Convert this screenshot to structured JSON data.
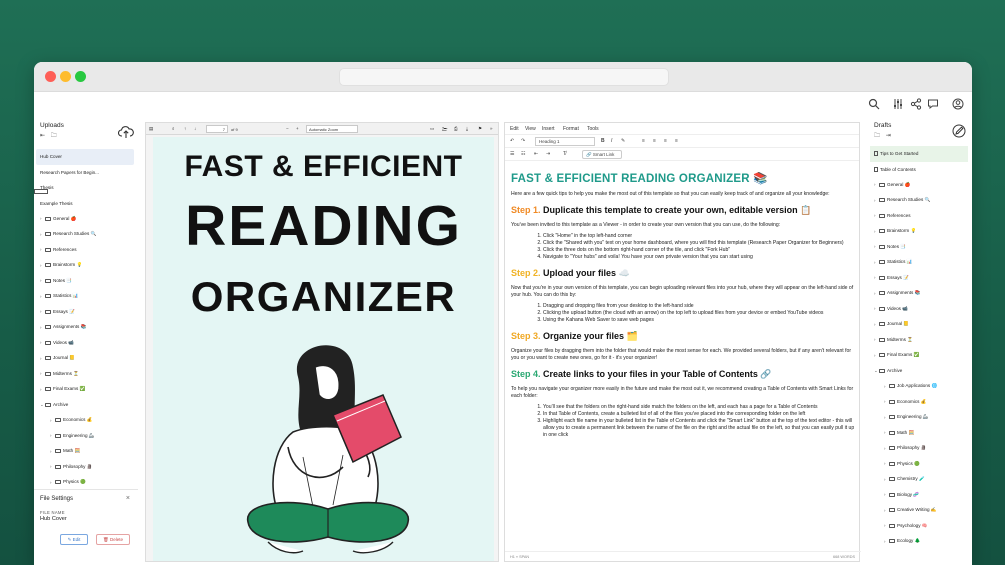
{
  "left_sidebar": {
    "title": "Uploads",
    "items": [
      {
        "label": "Hub Cover",
        "type": "file",
        "selected": true,
        "indent": 0
      },
      {
        "label": "Research Papers for Begin...",
        "type": "file",
        "indent": 0
      },
      {
        "label": "Thesis",
        "type": "file",
        "indent": 0
      },
      {
        "label": "Example Thesis",
        "type": "file",
        "indent": 0
      },
      {
        "label": "General 🍎",
        "type": "folder",
        "indent": 0
      },
      {
        "label": "Research Studies 🔍",
        "type": "folder",
        "indent": 0
      },
      {
        "label": "References",
        "type": "folder",
        "indent": 0
      },
      {
        "label": "Brainstorm 💡",
        "type": "folder",
        "indent": 0
      },
      {
        "label": "Notes 📑",
        "type": "folder",
        "indent": 0
      },
      {
        "label": "Statistics 📊",
        "type": "folder",
        "indent": 0
      },
      {
        "label": "Essays 📝",
        "type": "folder",
        "indent": 0
      },
      {
        "label": "Assignments 📚",
        "type": "folder",
        "indent": 0
      },
      {
        "label": "Videos 📹",
        "type": "folder",
        "indent": 0
      },
      {
        "label": "Journal 📒",
        "type": "folder",
        "indent": 0
      },
      {
        "label": "Midterms ⏳",
        "type": "folder",
        "indent": 0
      },
      {
        "label": "Final Exams ✅",
        "type": "folder",
        "indent": 0
      },
      {
        "label": "Archive",
        "type": "folder",
        "indent": 0
      },
      {
        "label": "Economics 💰",
        "type": "folder",
        "indent": 1
      },
      {
        "label": "Engineering 🦾",
        "type": "folder",
        "indent": 1
      },
      {
        "label": "Math 🧮",
        "type": "folder",
        "indent": 1
      },
      {
        "label": "Philosophy 🗿",
        "type": "folder",
        "indent": 1
      },
      {
        "label": "Physics 🟢",
        "type": "folder",
        "indent": 1
      }
    ]
  },
  "file_settings": {
    "title": "File Settings",
    "close": "×",
    "field_label": "FILE NAME",
    "field_value": "Hub Cover",
    "edit_label": "✎ Edit",
    "delete_label": "🗑 Delete"
  },
  "pdf_viewer": {
    "page_current": "7",
    "page_total": "of 9",
    "zoom": "Automatic Zoom",
    "cover_line1": "FAST & EFFICIENT",
    "cover_line2": "READING",
    "cover_line3": "ORGANIZER"
  },
  "editor": {
    "menu": [
      "Edit",
      "View",
      "Insert",
      "Format",
      "Tools"
    ],
    "block_style": "Heading 1",
    "smart_link": "Smart Link",
    "title": "FAST & EFFICIENT READING ORGANIZER 📚",
    "intro": "Here are a few quick tips to help you make the most out of this template so that you can easily keep track of and organize all your knowledge:",
    "step1_num": "Step 1.",
    "step1_title": "Duplicate this template to create your own, editable version 📋",
    "step1_text": "You've been invited to this template as a Viewer - in order to create your own version that you can use, do the following:",
    "step1_items": [
      "Click \"Home\" in the top left-hand corner",
      "Click the \"Shared with you\" text on your home dashboard, where you will find this template (Research Paper Organizer for Beginners)",
      "Click the three dots on the bottom right-hand corner of the tile, and click \"Fork Hub\"",
      "Navigate to \"Your hubs\" and voila! You have your own private version that you can start using"
    ],
    "step2_num": "Step 2.",
    "step2_title": "Upload your files ☁️",
    "step2_text": "Now that you're in your own version of this template, you can begin uploading relevant files into your hub, where they will appear on the left-hand side of your hub. You can do this by:",
    "step2_items": [
      "Dragging and dropping files from your desktop to the left-hand side",
      "Clicking the upload button (the cloud with an arrow) on the top left to upload files from your device or embed YouTube videos",
      "Using the Kahana Web Saver to save web pages"
    ],
    "step3_num": "Step 3.",
    "step3_title": "Organize your files 🗂️",
    "step3_text": "Organize your files by dragging them into the folder that would make the most sense for each. We provided several folders, but if any aren't relevant for you or you want to create new ones, go for it - it's your organizer!",
    "step4_num": "Step 4.",
    "step4_title": "Create links to your files in your Table of Contents 🔗",
    "step4_text": "To help you navigate your organizer more easily in the future and make the most out it, we recommend creating a Table of Contents with Smart Links for each folder:",
    "step4_items": [
      "You'll see that the folders on the right-hand side match the folders on the left, and each has a page for a Table of Contents",
      "In that Table of Contents, create a bulleted list of all of the files you've placed into the corresponding folder on the left",
      "Highlight each file name in your bulleted list in the Table of Contents and click the \"Smart Link\" button at the top of the text editor - this will allow you to create a permanent link between the name of the file on the right and the actual file on the left, so that you can easily pull it up in one click"
    ],
    "status_path": "H1 » SPAN",
    "status_words": "668 WORDS"
  },
  "right_sidebar": {
    "title": "Drafts",
    "items": [
      {
        "label": "Tips to Get Started",
        "type": "doc",
        "selected": true,
        "indent": 0
      },
      {
        "label": "Table of Contents",
        "type": "doc",
        "indent": 0
      },
      {
        "label": "General 🍎",
        "type": "folder",
        "indent": 0
      },
      {
        "label": "Research Studies 🔍",
        "type": "folder",
        "indent": 0
      },
      {
        "label": "References",
        "type": "folder",
        "indent": 0
      },
      {
        "label": "Brainstorm 💡",
        "type": "folder",
        "indent": 0
      },
      {
        "label": "Notes 📑",
        "type": "folder",
        "indent": 0
      },
      {
        "label": "Statistics 📊",
        "type": "folder",
        "indent": 0
      },
      {
        "label": "Essays 📝",
        "type": "folder",
        "indent": 0
      },
      {
        "label": "Assignments 📚",
        "type": "folder",
        "indent": 0
      },
      {
        "label": "Videos 📹",
        "type": "folder",
        "indent": 0
      },
      {
        "label": "Journal 📒",
        "type": "folder",
        "indent": 0
      },
      {
        "label": "Midterms ⏳",
        "type": "folder",
        "indent": 0
      },
      {
        "label": "Final Exams ✅",
        "type": "folder",
        "indent": 0
      },
      {
        "label": "Archive",
        "type": "folder",
        "indent": 0
      },
      {
        "label": "Job Applications 🌐",
        "type": "folder",
        "indent": 1
      },
      {
        "label": "Economics 💰",
        "type": "folder",
        "indent": 1
      },
      {
        "label": "Engineering 🦾",
        "type": "folder",
        "indent": 1
      },
      {
        "label": "Math 🧮",
        "type": "folder",
        "indent": 1
      },
      {
        "label": "Philosophy 🗿",
        "type": "folder",
        "indent": 1
      },
      {
        "label": "Physics 🟢",
        "type": "folder",
        "indent": 1
      },
      {
        "label": "Chemistry 🧪",
        "type": "folder",
        "indent": 1
      },
      {
        "label": "Biology 🧬",
        "type": "folder",
        "indent": 1
      },
      {
        "label": "Creative Writing ✍️",
        "type": "folder",
        "indent": 1
      },
      {
        "label": "Psychology 🧠",
        "type": "folder",
        "indent": 1
      },
      {
        "label": "Ecology 🌲",
        "type": "folder",
        "indent": 1
      }
    ]
  },
  "colors": {
    "background": "#1b6650",
    "accent_teal": "#1f9a8a",
    "step_orange": "#f08a24",
    "step_green": "#2aa872"
  }
}
